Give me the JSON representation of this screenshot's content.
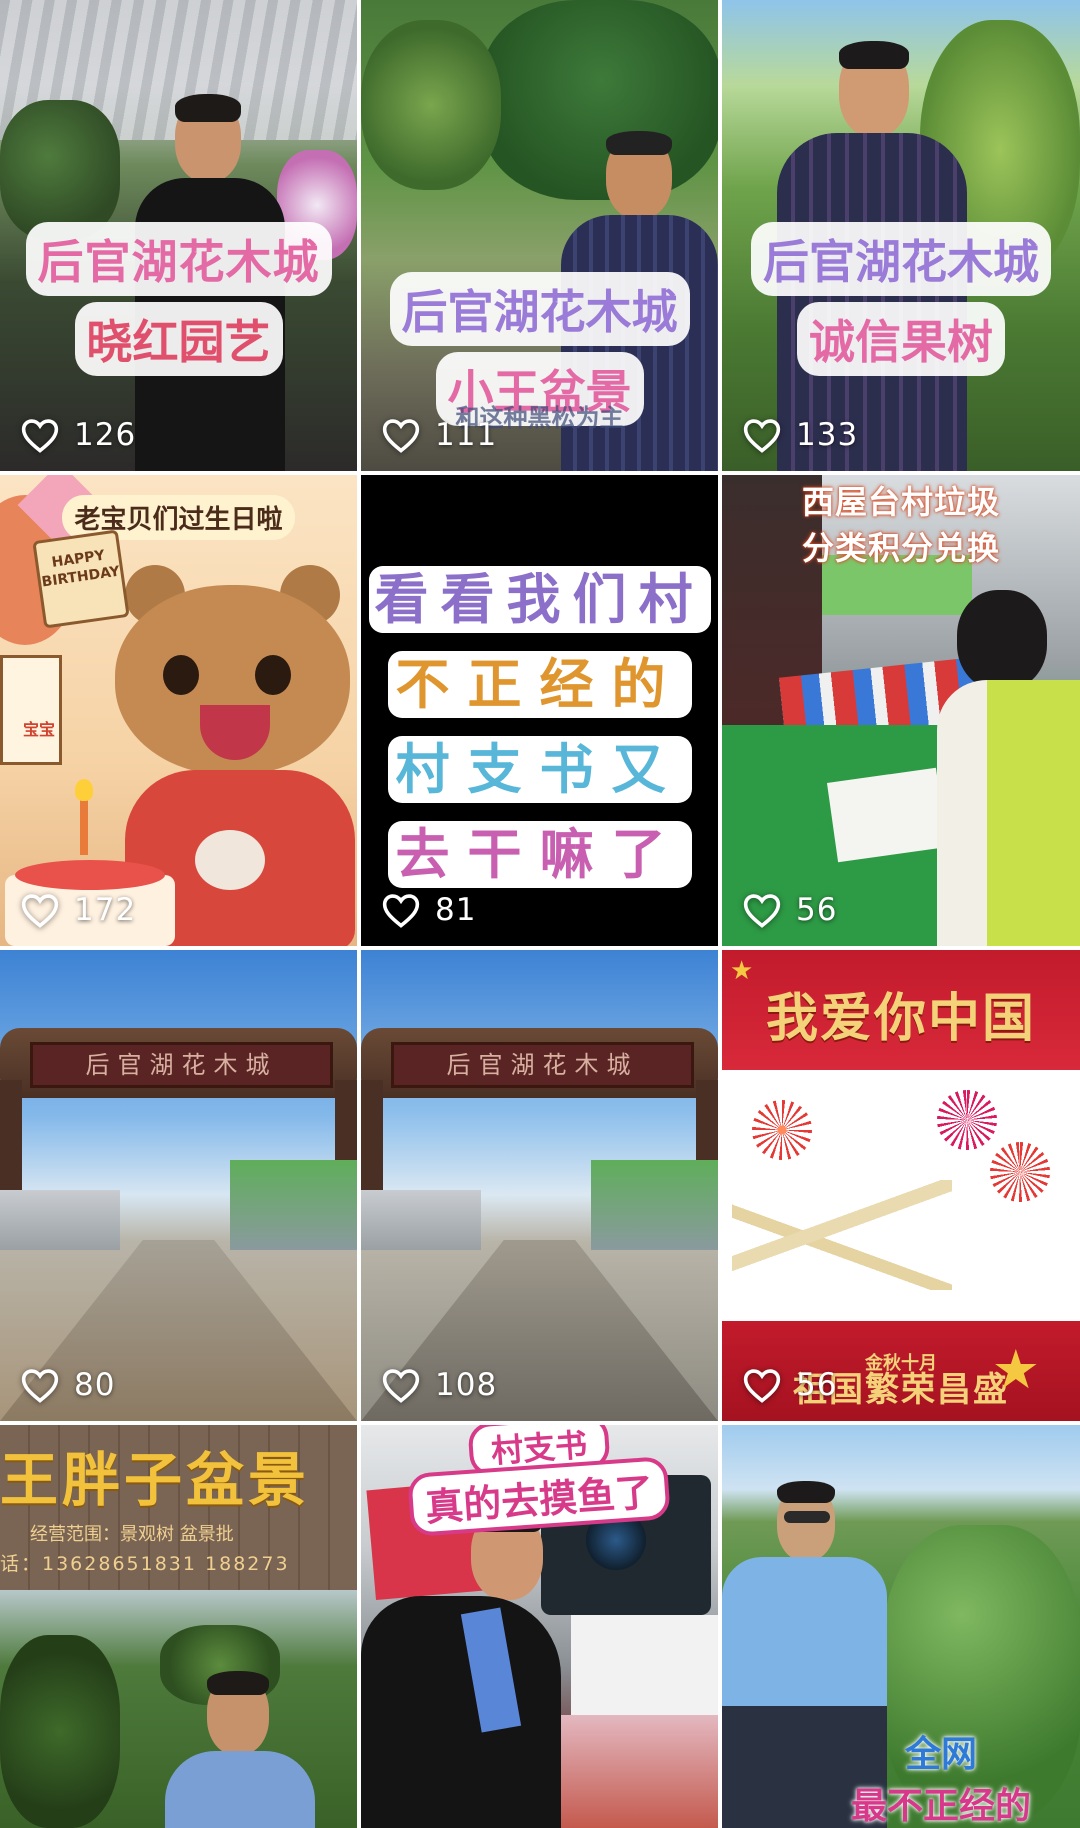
{
  "tiles": [
    {
      "likes": "126",
      "caption_line1": "后官湖花木城",
      "caption_line2": "晓红园艺"
    },
    {
      "likes": "111",
      "caption_line1": "后官湖花木城",
      "caption_line2": "小王盆景",
      "subtitle": "和这种黑松为主"
    },
    {
      "likes": "133",
      "caption_line1": "后官湖花木城",
      "caption_line2": "诚信果树"
    },
    {
      "likes": "172",
      "caption": "老宝贝们过生日啦",
      "sign_text": "HAPPY BIRTHDAY",
      "board_text": "宝宝"
    },
    {
      "likes": "81",
      "lines": [
        "看看我们村",
        "不正经的",
        "村支书又",
        "去干嘛了"
      ]
    },
    {
      "likes": "56",
      "caption_line1": "西屋台村垃圾",
      "caption_line2": "分类积分兑换"
    },
    {
      "likes": "80",
      "gate_text": "后官湖花木城"
    },
    {
      "likes": "108",
      "gate_text": "后官湖花木城"
    },
    {
      "likes": "56",
      "caption": "我爱你中国",
      "footer_text": "祖国繁荣昌盛",
      "footer_small": "金秋十月"
    },
    {
      "sign_title": "王胖子盆景",
      "sign_line": "经营范围：景观树 盆景批",
      "phone": "话：13628651831 188273"
    },
    {
      "caption_line1": "村支书",
      "caption_line2": "真的去摸鱼了"
    },
    {
      "caption_line1": "全网",
      "caption_line2": "最不正经的"
    }
  ],
  "icons": {
    "like": "heart-outline-icon"
  },
  "colors": {
    "pink": "#e46aa6",
    "purple": "#9a7bd8",
    "green": "#66bf78",
    "gold": "#d8b14b",
    "blue": "#78b6e3"
  }
}
